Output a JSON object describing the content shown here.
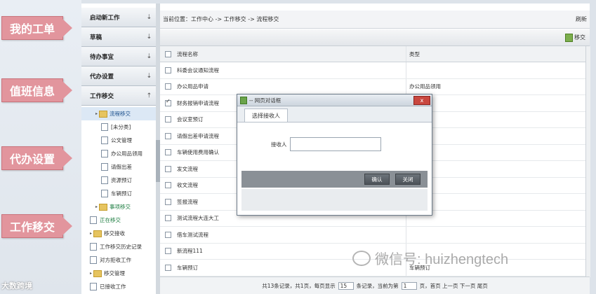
{
  "callouts": [
    "我的工单",
    "值班信息",
    "代办设置",
    "工作移交"
  ],
  "watermark_left": "大数跨境",
  "watermark_right": "微信号: huizhengtech",
  "sidebar": {
    "sections": [
      "启动新工作",
      "草稿",
      "待办事宜",
      "代办设置",
      "工作移交"
    ],
    "tree": [
      {
        "label": "流程移交",
        "kind": "folder",
        "indent": 1,
        "selected": true
      },
      {
        "label": "[未分类]",
        "kind": "doc",
        "indent": 2
      },
      {
        "label": "公文管理",
        "kind": "doc",
        "indent": 2
      },
      {
        "label": "办公用品领用",
        "kind": "doc",
        "indent": 2
      },
      {
        "label": "请假出差",
        "kind": "doc",
        "indent": 2
      },
      {
        "label": "资源预订",
        "kind": "doc",
        "indent": 2
      },
      {
        "label": "车辆预订",
        "kind": "doc",
        "indent": 2
      },
      {
        "label": "事项移交",
        "kind": "folder",
        "indent": 1
      },
      {
        "label": "正在移交",
        "kind": "doc",
        "indent": 0
      },
      {
        "label": "移交接收",
        "kind": "folder",
        "indent": 0
      },
      {
        "label": "工作移交历史记录",
        "kind": "doc",
        "indent": 0
      },
      {
        "label": "对方拒收工作",
        "kind": "doc",
        "indent": 0
      },
      {
        "label": "移交管理",
        "kind": "folder",
        "indent": 0
      },
      {
        "label": "已接收工作",
        "kind": "doc",
        "indent": 0
      }
    ]
  },
  "breadcrumb": {
    "text": "当前位置：工作中心 -> 工作移交 -> 流程移交",
    "refresh": "刷新"
  },
  "toolbar": {
    "handover": "移交"
  },
  "grid": {
    "headers": {
      "name": "流程名称",
      "type": "类型"
    },
    "rows": [
      {
        "name": "科委会议通知流程",
        "type": "",
        "checked": false
      },
      {
        "name": "办公用品申请",
        "type": "办公用品领用",
        "checked": false
      },
      {
        "name": "财务报销申请流程",
        "type": "",
        "checked": true
      },
      {
        "name": "会议室预订",
        "type": "",
        "checked": false
      },
      {
        "name": "请假出差申请流程",
        "type": "",
        "checked": false
      },
      {
        "name": "车辆使用费用确认",
        "type": "",
        "checked": false
      },
      {
        "name": "发文流程",
        "type": "",
        "checked": false
      },
      {
        "name": "收文流程",
        "type": "",
        "checked": false
      },
      {
        "name": "签报流程",
        "type": "",
        "checked": false
      },
      {
        "name": "测试流程大连大工",
        "type": "",
        "checked": false
      },
      {
        "name": "借车测试流程",
        "type": "",
        "checked": false
      },
      {
        "name": "新流程111",
        "type": "",
        "checked": false
      },
      {
        "name": "车辆预订",
        "type": "车辆预订",
        "checked": false
      }
    ]
  },
  "pager": {
    "prefix": "共13条记录，共1页，每页显示",
    "per_page": "15",
    "middle": "条记录，当前为第",
    "current": "1",
    "suffix": "页，首页 上一页 下一页 尾页"
  },
  "dialog": {
    "title": "-- 网页对话框",
    "close": "x",
    "tab": "选择接收人",
    "receiver_label": "接收人",
    "confirm": "确认",
    "close_btn": "关闭"
  }
}
